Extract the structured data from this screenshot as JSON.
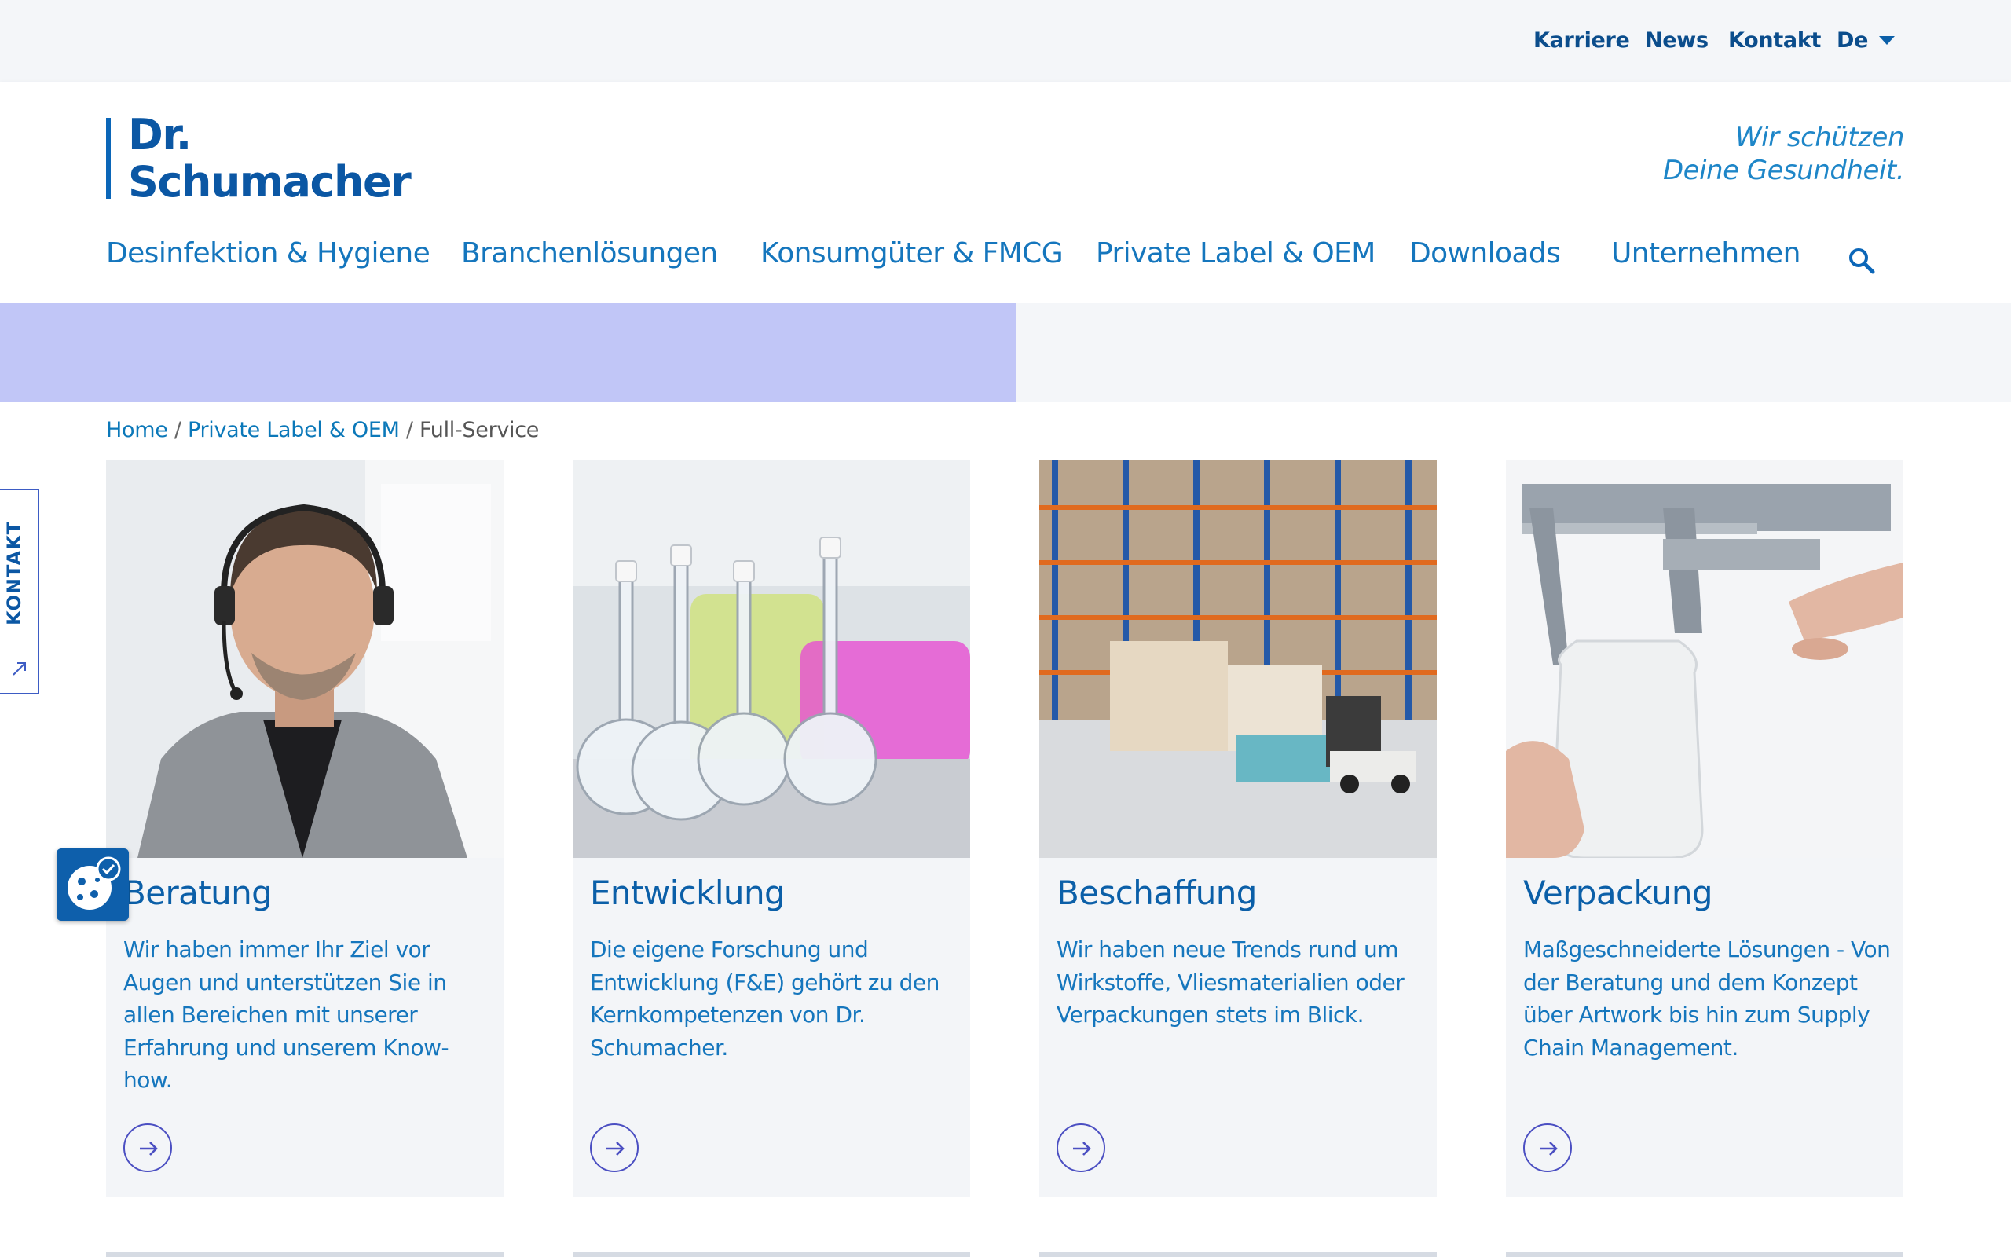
{
  "topbar": {
    "links": [
      "Karriere",
      "News",
      "Kontakt"
    ],
    "language": "De"
  },
  "header": {
    "logo_line1": "Dr.",
    "logo_line2": "Schumacher",
    "tagline_line1": "Wir schützen",
    "tagline_line2": "Deine Gesundheit.",
    "nav": [
      "Desinfektion & Hygiene",
      "Branchenlösungen",
      "Konsumgüter & FMCG",
      "Private Label & OEM",
      "Downloads",
      "Unternehmen"
    ]
  },
  "breadcrumb": {
    "items": [
      "Home",
      "Private Label & OEM"
    ],
    "separator": "/",
    "current": "Full-Service"
  },
  "cards": [
    {
      "title": "Beratung",
      "description": "Wir haben immer Ihr Ziel vor Augen und unterstützen Sie in allen Bereichen mit unserer Erfahrung und unserem Know-how.",
      "image": "consultant-with-headset"
    },
    {
      "title": "Entwicklung",
      "description": "Die eigene Forschung und Entwicklung (F&E) gehört zu den Kernkompetenzen von Dr. Schumacher.",
      "image": "laboratory-flasks"
    },
    {
      "title": "Beschaffung",
      "description": "Wir haben neue Trends rund um Wirkstoffe, Vliesmaterialien oder Verpackungen stets im Blick.",
      "image": "warehouse-forklift"
    },
    {
      "title": "Verpackung",
      "description": "Maßgeschneiderte Lösungen - Von der Beratung und dem Konzept über Artwork bis hin zum Supply Chain Management.",
      "image": "caliper-measuring-bottle"
    }
  ],
  "side_tab": {
    "label": "KONTAKT"
  },
  "colors": {
    "primary": "#0b5fa8",
    "link": "#1576bd",
    "banner": "#c1c6f7",
    "accent_ring": "#4b4fc2",
    "background_light": "#f4f6f9"
  }
}
